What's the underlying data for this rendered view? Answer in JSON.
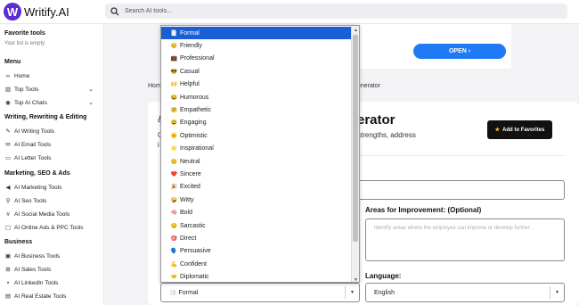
{
  "app": {
    "logo_letter": "W",
    "name": "Writify.AI"
  },
  "search": {
    "placeholder": "Search AI tools..."
  },
  "sidebar": {
    "favorites_title": "Favorite tools",
    "favorites_empty": "Your list is empty",
    "menu_title": "Menu",
    "menu_items": [
      {
        "icon": "link-icon",
        "label": "Home"
      },
      {
        "icon": "chart-icon",
        "label": "Top Tools"
      },
      {
        "icon": "chat-icon",
        "label": "Top AI Chats"
      }
    ],
    "writing_title": "Writing, Rewriting & Editing",
    "writing_items": [
      {
        "icon": "pen-icon",
        "label": "AI Writing Tools"
      },
      {
        "icon": "mail-icon",
        "label": "AI Email Tools"
      },
      {
        "icon": "letter-icon",
        "label": "AI Letter Tools"
      }
    ],
    "marketing_title": "Marketing, SEO & Ads",
    "marketing_items": [
      {
        "icon": "megaphone-icon",
        "label": "AI Marketing Tools"
      },
      {
        "icon": "search-icon",
        "label": "AI Seo Tools"
      },
      {
        "icon": "hashtag-icon",
        "label": "AI Social Media Tools"
      },
      {
        "icon": "ads-icon",
        "label": "AI Online Ads & PPC Tools"
      }
    ],
    "business_title": "Business",
    "business_items": [
      {
        "icon": "briefcase-icon",
        "label": "AI Business Tools"
      },
      {
        "icon": "sales-icon",
        "label": "AI Sales Tools"
      },
      {
        "icon": "linkedin-icon",
        "label": "AI LinkedIn Tools"
      },
      {
        "icon": "building-icon",
        "label": "AI Real Estate Tools"
      }
    ]
  },
  "banner": {
    "open_label": "OPEN"
  },
  "breadcrumb": {
    "home_fragment": "Hom",
    "tool_fragment": "enerator"
  },
  "tool": {
    "title_fragment": "erator",
    "desc_fragment": "strengths, address",
    "desc_left_fragment": "C",
    "desc_left_fragment2": "i",
    "icon_fragment": "&",
    "add_to_favorites": "Add to Favorites"
  },
  "form": {
    "areas_label": "Areas for Improvement: (Optional)",
    "areas_placeholder": "Identify areas where the employee can improve or develop further.",
    "language_label": "Language:",
    "language_value": "English",
    "tone_value": "Formal"
  },
  "tone_options": [
    {
      "icon": "📑",
      "label": "Formal"
    },
    {
      "icon": "😊",
      "label": "Friendly"
    },
    {
      "icon": "💼",
      "label": "Professional"
    },
    {
      "icon": "😎",
      "label": "Casual"
    },
    {
      "icon": "🙌",
      "label": "Helpful"
    },
    {
      "icon": "😂",
      "label": "Humorous"
    },
    {
      "icon": "🤗",
      "label": "Empathetic"
    },
    {
      "icon": "😃",
      "label": "Engaging"
    },
    {
      "icon": "🌞",
      "label": "Optimistic"
    },
    {
      "icon": "🌟",
      "label": "Inspirational"
    },
    {
      "icon": "😐",
      "label": "Neutral"
    },
    {
      "icon": "❤️",
      "label": "Sincere"
    },
    {
      "icon": "🎉",
      "label": "Excited"
    },
    {
      "icon": "🤪",
      "label": "Witty"
    },
    {
      "icon": "🧠",
      "label": "Bold"
    },
    {
      "icon": "😏",
      "label": "Sarcastic"
    },
    {
      "icon": "🎯",
      "label": "Direct"
    },
    {
      "icon": "🗣️",
      "label": "Persuasive"
    },
    {
      "icon": "💪",
      "label": "Confident"
    },
    {
      "icon": "🤝",
      "label": "Diplomatic"
    }
  ],
  "colors": {
    "accent": "#1a5ed6",
    "brand": "#5b2bd6",
    "open_button": "#1e7bf5"
  }
}
